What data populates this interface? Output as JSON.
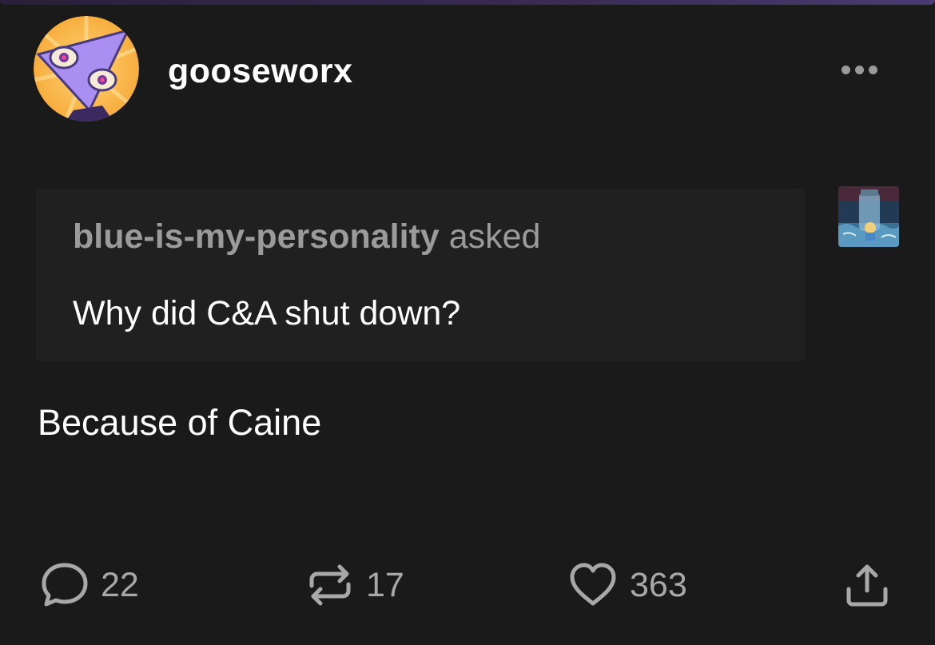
{
  "post": {
    "author": "gooseworx",
    "more_icon": "ellipsis-icon"
  },
  "ask": {
    "asker": "blue-is-my-personality",
    "verb": "asked",
    "question": "Why did C&A shut down?"
  },
  "answer": {
    "text": "Because of Caine"
  },
  "actions": {
    "replies": "22",
    "reblogs": "17",
    "likes": "363"
  },
  "colors": {
    "background": "#1a1a1a",
    "ask_box": "#202020",
    "muted_text": "#9b9b9b",
    "icon": "#a8a8a8"
  }
}
